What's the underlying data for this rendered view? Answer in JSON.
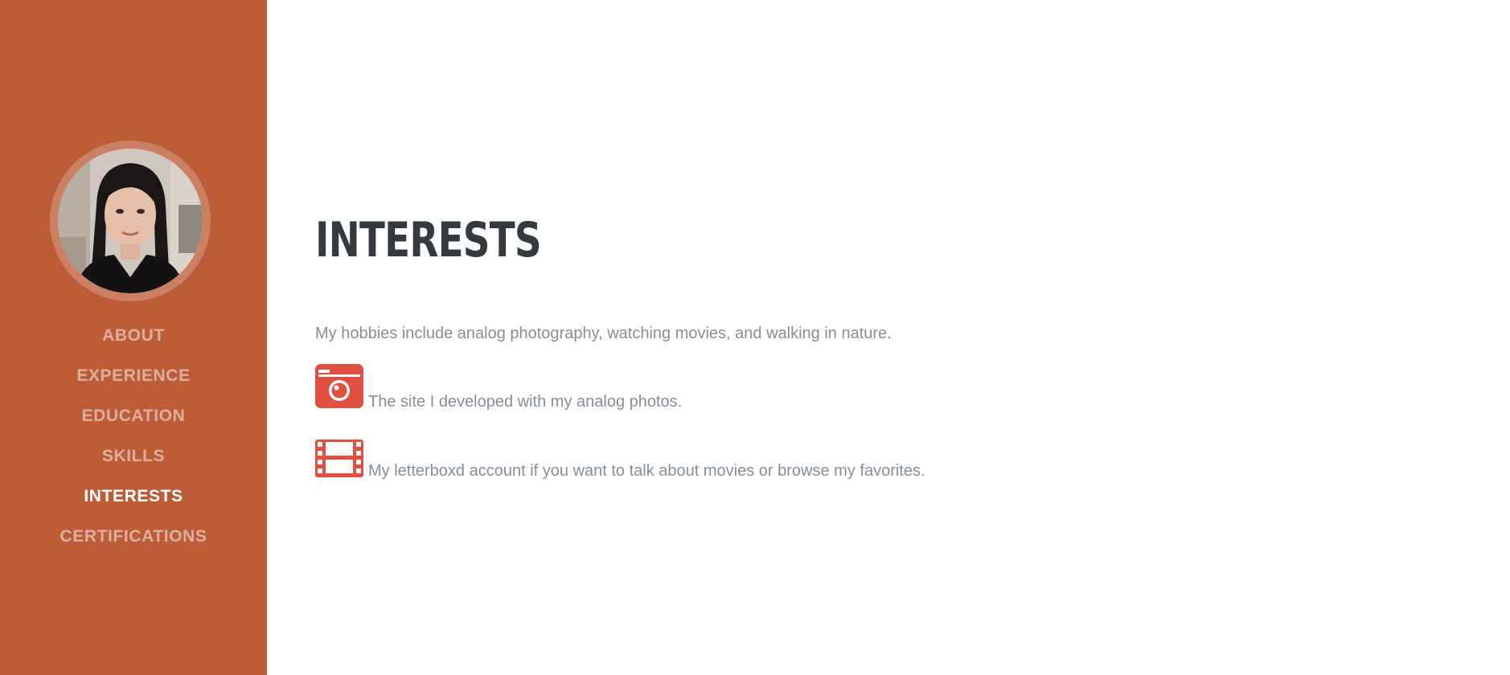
{
  "sidebar": {
    "avatar_alt": "profile photo",
    "nav": [
      {
        "label": "ABOUT",
        "active": false
      },
      {
        "label": "EXPERIENCE",
        "active": false
      },
      {
        "label": "EDUCATION",
        "active": false
      },
      {
        "label": "SKILLS",
        "active": false
      },
      {
        "label": "INTERESTS",
        "active": true
      },
      {
        "label": "CERTIFICATIONS",
        "active": false
      }
    ]
  },
  "main": {
    "heading": "INTERESTS",
    "intro": "My hobbies include analog photography, watching movies, and walking in nature.",
    "links": [
      {
        "icon": "camera-icon",
        "text": "The site I developed with my analog photos."
      },
      {
        "icon": "film-icon",
        "text": "My letterboxd account if you want to talk about movies or browse my favorites."
      }
    ]
  },
  "colors": {
    "sidebar_bg": "#bd5d38",
    "heading": "#343a40",
    "body_text": "#868e96",
    "icon": "#e04f3f"
  }
}
